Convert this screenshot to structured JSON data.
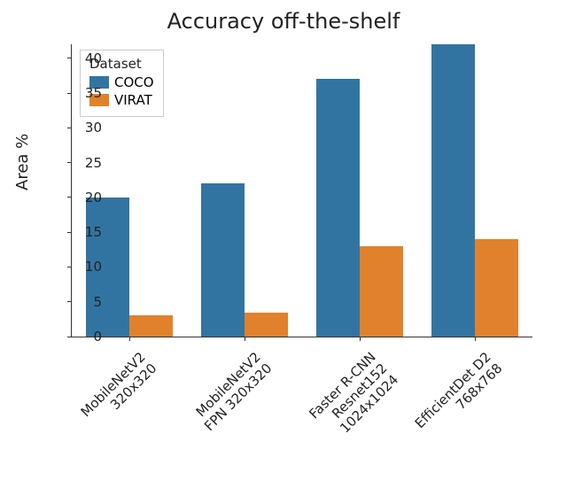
{
  "chart_data": {
    "type": "bar",
    "title": "Accuracy off-the-shelf",
    "ylabel": "Area %",
    "xlabel": "",
    "categories": [
      "MobileNetV2\n320x320",
      "MobileNetV2\nFPN 320x320",
      "Faster R-CNN\nResnet152\n1024x1024",
      "EfficientDet D2\n768x768"
    ],
    "series": [
      {
        "name": "COCO",
        "values": [
          20,
          22,
          37,
          42
        ],
        "color": "#3274a1"
      },
      {
        "name": "VIRAT",
        "values": [
          3,
          3.5,
          13,
          14
        ],
        "color": "#e1812c"
      }
    ],
    "ylim": [
      0,
      42
    ],
    "yticks": [
      0,
      5,
      10,
      15,
      20,
      25,
      30,
      35,
      40
    ],
    "legend_title": "Dataset",
    "legend_position": "upper left"
  }
}
